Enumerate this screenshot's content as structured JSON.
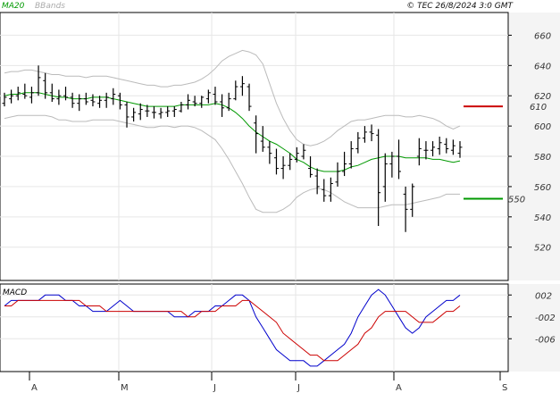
{
  "copyright": "© TEC 26/8/2024 3:0 GMT",
  "legend": {
    "ma": "MA20",
    "bands": "BBands"
  },
  "macd_label": "MACD",
  "colors": {
    "price": "#000000",
    "ma": "#009900",
    "bands": "#bbbbbb",
    "macd": "#0000cc",
    "signal": "#cc0000",
    "resistance": "#cc0000",
    "support": "#009900",
    "grid": "#e6e6e6"
  },
  "chart_data": [
    {
      "type": "line",
      "title": "",
      "ylim": [
        498,
        675
      ],
      "y_ticks": [
        520,
        540,
        560,
        580,
        600,
        620,
        640,
        660
      ],
      "x_month_labels": [
        "A",
        "M",
        "J",
        "J",
        "A",
        "S"
      ],
      "levels": [
        {
          "label": "610",
          "value": 613
        },
        {
          "label": "550",
          "value": 552
        }
      ],
      "series": [
        {
          "name": "MA20",
          "values": [
            620,
            621,
            621,
            622,
            622,
            622,
            621,
            620,
            619,
            619,
            618,
            618,
            618,
            619,
            619,
            619,
            618,
            617,
            616,
            615,
            614,
            613,
            613,
            613,
            613,
            613,
            614,
            614,
            614,
            614,
            614,
            615,
            614,
            612,
            609,
            605,
            600,
            596,
            593,
            590,
            588,
            585,
            582,
            578,
            576,
            573,
            571,
            570,
            570,
            570,
            571,
            573,
            574,
            576,
            578,
            579,
            580,
            580,
            580,
            579,
            579,
            579,
            579,
            578,
            578,
            577,
            576,
            577
          ]
        },
        {
          "name": "BBands",
          "values": [
            635,
            636,
            636,
            637,
            637,
            636,
            635,
            634,
            634,
            633,
            633,
            633,
            632,
            633,
            633,
            633,
            632,
            631,
            630,
            629,
            628,
            627,
            627,
            626,
            626,
            627,
            627,
            628,
            629,
            631,
            634,
            638,
            643,
            646,
            648,
            650,
            649,
            647,
            641,
            628,
            615,
            605,
            597,
            591,
            588,
            587,
            588,
            590,
            593,
            597,
            600,
            603,
            604,
            604,
            605,
            606,
            607,
            607,
            607,
            606,
            606,
            607,
            606,
            605,
            603,
            600,
            598,
            600
          ]
        },
        {
          "name": "BBands lower",
          "values": [
            605,
            606,
            607,
            607,
            607,
            607,
            607,
            606,
            604,
            604,
            603,
            603,
            603,
            604,
            604,
            604,
            604,
            603,
            602,
            601,
            600,
            599,
            599,
            600,
            600,
            599,
            600,
            600,
            599,
            597,
            594,
            591,
            585,
            578,
            570,
            562,
            553,
            545,
            543,
            543,
            543,
            545,
            548,
            553,
            556,
            558,
            559,
            558,
            556,
            553,
            550,
            548,
            546,
            546,
            546,
            546,
            547,
            548,
            548,
            548,
            549,
            550,
            551,
            552,
            553,
            555,
            555,
            555
          ]
        }
      ],
      "ohlc": [
        [
          615,
          622,
          613,
          619
        ],
        [
          618,
          624,
          615,
          620
        ],
        [
          620,
          626,
          617,
          622
        ],
        [
          621,
          628,
          618,
          620
        ],
        [
          619,
          626,
          615,
          622
        ],
        [
          622,
          640,
          620,
          632
        ],
        [
          630,
          635,
          618,
          622
        ],
        [
          622,
          628,
          616,
          618
        ],
        [
          618,
          624,
          614,
          620
        ],
        [
          620,
          626,
          617,
          619
        ],
        [
          619,
          622,
          612,
          615
        ],
        [
          615,
          621,
          610,
          618
        ],
        [
          618,
          622,
          614,
          616
        ],
        [
          617,
          621,
          613,
          616
        ],
        [
          615,
          620,
          612,
          617
        ],
        [
          617,
          622,
          612,
          619
        ],
        [
          618,
          625,
          614,
          621
        ],
        [
          620,
          622,
          611,
          614
        ],
        [
          614,
          616,
          599,
          606
        ],
        [
          606,
          612,
          603,
          609
        ],
        [
          608,
          615,
          604,
          611
        ],
        [
          610,
          614,
          606,
          610
        ],
        [
          609,
          613,
          605,
          609
        ],
        [
          608,
          612,
          605,
          609
        ],
        [
          609,
          613,
          606,
          610
        ],
        [
          610,
          613,
          606,
          611
        ],
        [
          610,
          616,
          609,
          614
        ],
        [
          614,
          621,
          611,
          617
        ],
        [
          616,
          620,
          613,
          615
        ],
        [
          615,
          620,
          612,
          619
        ],
        [
          618,
          624,
          615,
          622
        ],
        [
          621,
          626,
          614,
          616
        ],
        [
          616,
          621,
          606,
          612
        ],
        [
          612,
          622,
          610,
          618
        ],
        [
          618,
          630,
          617,
          626
        ],
        [
          626,
          633,
          620,
          628
        ],
        [
          626,
          628,
          610,
          613
        ],
        [
          602,
          607,
          582,
          595
        ],
        [
          590,
          600,
          583,
          586
        ],
        [
          586,
          590,
          575,
          582
        ],
        [
          579,
          585,
          568,
          572
        ],
        [
          572,
          580,
          565,
          574
        ],
        [
          574,
          582,
          571,
          578
        ],
        [
          578,
          586,
          576,
          582
        ],
        [
          580,
          588,
          578,
          584
        ],
        [
          572,
          580,
          566,
          568
        ],
        [
          567,
          572,
          555,
          560
        ],
        [
          558,
          565,
          550,
          554
        ],
        [
          554,
          566,
          550,
          562
        ],
        [
          563,
          576,
          560,
          570
        ],
        [
          570,
          583,
          567,
          575
        ],
        [
          575,
          590,
          572,
          585
        ],
        [
          585,
          596,
          582,
          592
        ],
        [
          592,
          600,
          589,
          596
        ],
        [
          596,
          601,
          590,
          595
        ],
        [
          594,
          598,
          534,
          556
        ],
        [
          560,
          582,
          550,
          575
        ],
        [
          575,
          583,
          566,
          580
        ],
        [
          580,
          591,
          565,
          570
        ],
        [
          555,
          560,
          530,
          545
        ],
        [
          545,
          562,
          540,
          560
        ],
        [
          580,
          592,
          574,
          585
        ],
        [
          584,
          590,
          578,
          584
        ],
        [
          584,
          590,
          580,
          586
        ],
        [
          585,
          593,
          581,
          589
        ],
        [
          588,
          592,
          582,
          585
        ],
        [
          584,
          591,
          581,
          587
        ],
        [
          582,
          590,
          579,
          586
        ]
      ]
    },
    {
      "type": "line",
      "title": "MACD",
      "ylim": [
        -0.012,
        0.004
      ],
      "y_ticks": [
        "002",
        "-002",
        "-006"
      ],
      "series": [
        {
          "name": "MACD",
          "values": [
            0,
            0.001,
            0.001,
            0.001,
            0.001,
            0.001,
            0.002,
            0.002,
            0.002,
            0.001,
            0.001,
            0,
            0,
            -0.001,
            -0.001,
            -0.001,
            0,
            0.001,
            0,
            -0.001,
            -0.001,
            -0.001,
            -0.001,
            -0.001,
            -0.001,
            -0.002,
            -0.002,
            -0.002,
            -0.001,
            -0.001,
            -0.001,
            0,
            0,
            0.001,
            0.002,
            0.002,
            0.001,
            -0.002,
            -0.004,
            -0.006,
            -0.008,
            -0.009,
            -0.01,
            -0.01,
            -0.01,
            -0.011,
            -0.011,
            -0.01,
            -0.009,
            -0.008,
            -0.007,
            -0.005,
            -0.002,
            0,
            0.002,
            0.003,
            0.002,
            0,
            -0.002,
            -0.004,
            -0.005,
            -0.004,
            -0.002,
            -0.001,
            0,
            0.001,
            0.001,
            0.002
          ]
        },
        {
          "name": "Signal",
          "values": [
            0,
            0,
            0.001,
            0.001,
            0.001,
            0.001,
            0.001,
            0.001,
            0.001,
            0.001,
            0.001,
            0.001,
            0,
            0,
            0,
            -0.001,
            -0.001,
            -0.001,
            -0.001,
            -0.001,
            -0.001,
            -0.001,
            -0.001,
            -0.001,
            -0.001,
            -0.001,
            -0.001,
            -0.002,
            -0.002,
            -0.001,
            -0.001,
            -0.001,
            0,
            0,
            0,
            0.001,
            0.001,
            0,
            -0.001,
            -0.002,
            -0.003,
            -0.005,
            -0.006,
            -0.007,
            -0.008,
            -0.009,
            -0.009,
            -0.01,
            -0.01,
            -0.01,
            -0.009,
            -0.008,
            -0.007,
            -0.005,
            -0.004,
            -0.002,
            -0.001,
            -0.001,
            -0.001,
            -0.001,
            -0.002,
            -0.003,
            -0.003,
            -0.003,
            -0.002,
            -0.001,
            -0.001,
            0
          ]
        }
      ]
    }
  ]
}
